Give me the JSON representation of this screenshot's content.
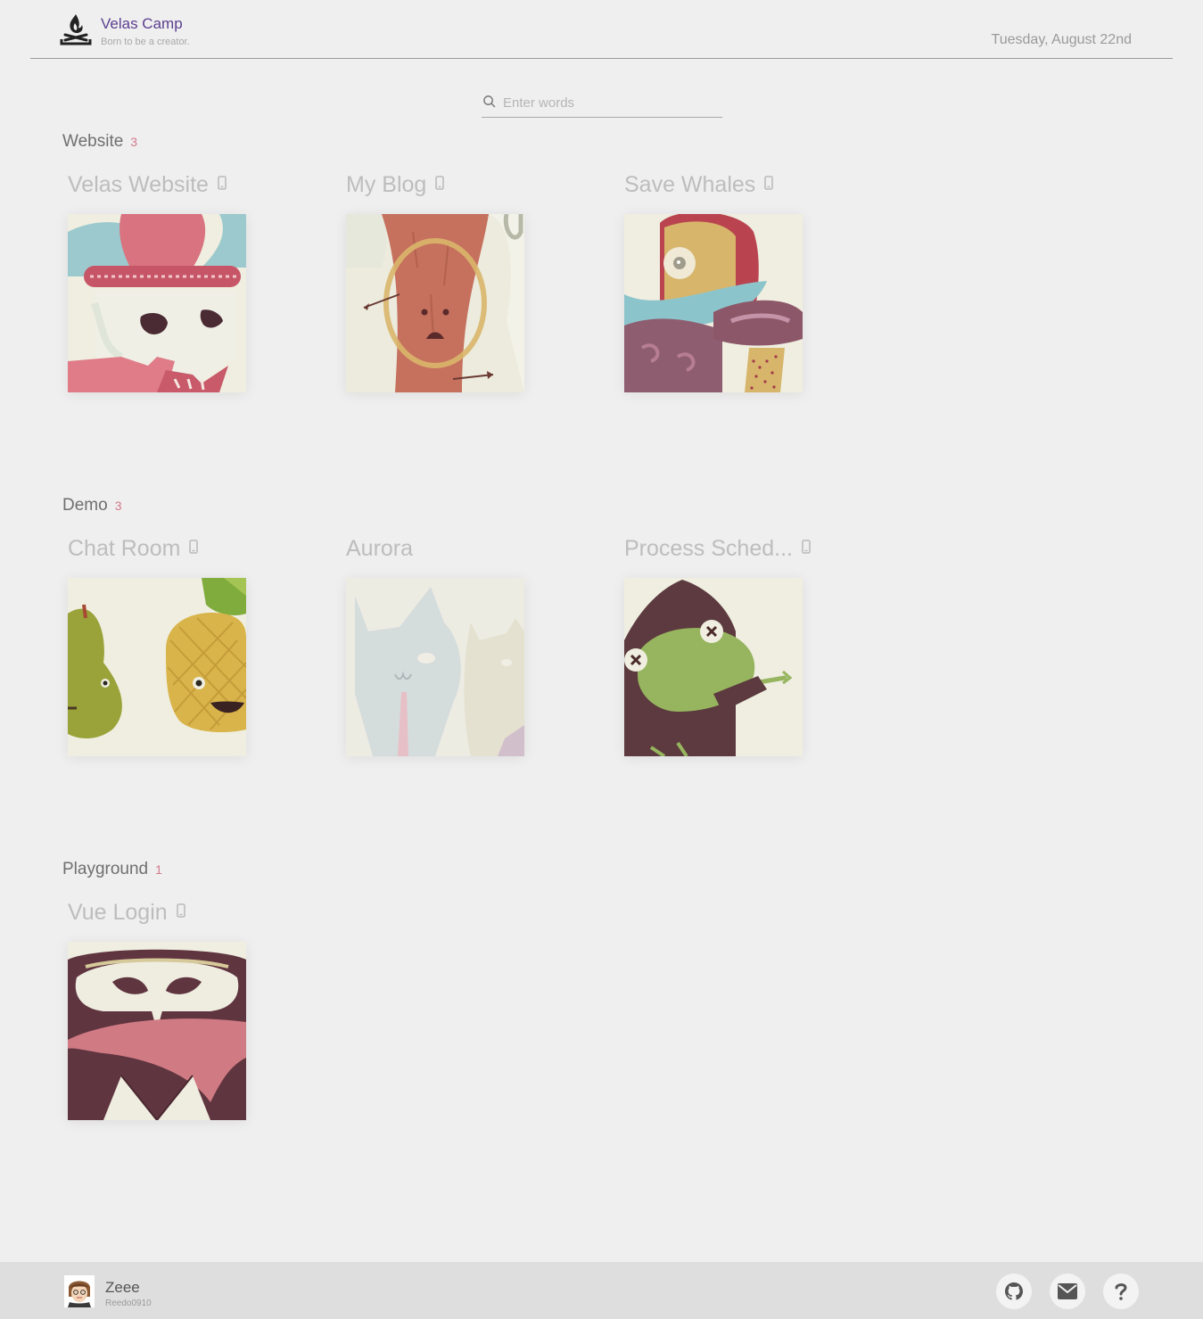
{
  "header": {
    "brand_name": "Velas Camp",
    "tagline": "Born to be a creator.",
    "date": "Tuesday, August 22nd"
  },
  "search": {
    "placeholder": "Enter words",
    "value": ""
  },
  "sections": [
    {
      "title": "Website",
      "count": "3",
      "cards": [
        {
          "title": "Velas Website",
          "mobile": true,
          "art": "jester-skull"
        },
        {
          "title": "My Blog",
          "mobile": true,
          "art": "tree-arrows"
        },
        {
          "title": "Save Whales",
          "mobile": true,
          "art": "hooded-cyclops"
        }
      ]
    },
    {
      "title": "Demo",
      "count": "3",
      "cards": [
        {
          "title": "Chat Room",
          "mobile": true,
          "art": "pear-pineapple"
        },
        {
          "title": "Aurora",
          "mobile": false,
          "art": "cats-tie"
        },
        {
          "title": "Process Sched...",
          "mobile": true,
          "art": "frog-wizard"
        }
      ]
    },
    {
      "title": "Playground",
      "count": "1",
      "cards": [
        {
          "title": "Vue Login",
          "mobile": true,
          "art": "owl-bandit"
        }
      ]
    }
  ],
  "footer": {
    "user_name": "Zeee",
    "user_id": "Reedo0910",
    "buttons": [
      "github-icon",
      "mail-icon",
      "help-icon"
    ]
  },
  "colors": {
    "background": "#efefef",
    "brand": "#5b3f8f",
    "count": "#d27a8a",
    "footer": "#dedede"
  }
}
